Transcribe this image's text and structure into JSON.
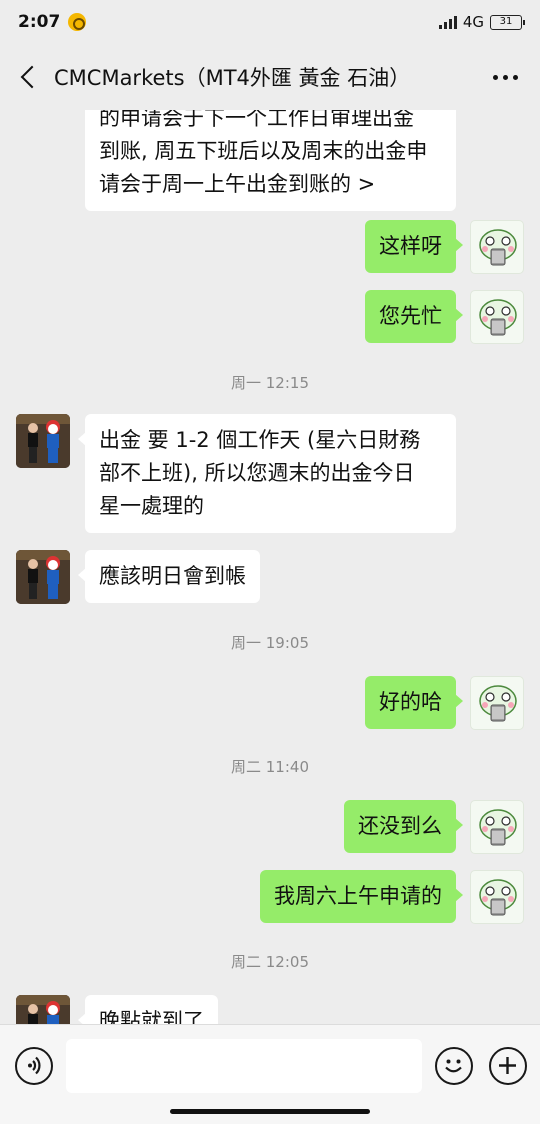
{
  "status_bar": {
    "time": "2:07",
    "network": "4G",
    "battery": "31"
  },
  "header": {
    "title": "CMCMarkets（MT4外匯 黃金 石油）"
  },
  "messages": [
    {
      "kind": "text",
      "side": "in",
      "text": "的申请会于下一个工作日审理出金\n到账, 周五下班后以及周末的出金申\n请会于周一上午出金到账的 >"
    },
    {
      "kind": "text",
      "side": "out",
      "text": "这样呀"
    },
    {
      "kind": "text",
      "side": "out",
      "text": "您先忙"
    },
    {
      "kind": "time",
      "text": "周一 12:15"
    },
    {
      "kind": "text",
      "side": "in",
      "text": "出金 要 1-2 個工作天 (星六日財務\n部不上班), 所以您週末的出金今日\n星一處理的"
    },
    {
      "kind": "text",
      "side": "in",
      "text": "應該明日會到帳"
    },
    {
      "kind": "time",
      "text": "周一 19:05"
    },
    {
      "kind": "text",
      "side": "out",
      "text": "好的哈"
    },
    {
      "kind": "time",
      "text": "周二 11:40"
    },
    {
      "kind": "text",
      "side": "out",
      "text": "还没到么"
    },
    {
      "kind": "text",
      "side": "out",
      "text": "我周六上午申请的"
    },
    {
      "kind": "time",
      "text": "周二 12:05"
    },
    {
      "kind": "text",
      "side": "in",
      "text": "晚點就到了"
    }
  ],
  "input_bar": {
    "placeholder": ""
  },
  "colors": {
    "background": "#ededed",
    "incoming_bubble": "#ffffff",
    "outgoing_bubble": "#95ec69",
    "timestamp": "#8a8a8a"
  },
  "icons": [
    "back-icon",
    "more-icon",
    "voice-icon",
    "emoji-icon",
    "plus-icon"
  ]
}
